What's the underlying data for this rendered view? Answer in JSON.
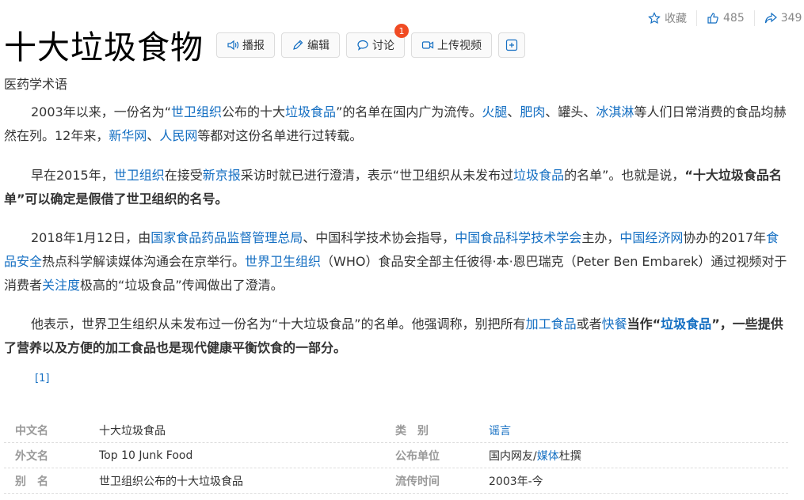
{
  "topbar": {
    "collect_label": "收藏",
    "like_count": "485",
    "share_count": "349"
  },
  "title": "十大垃圾食物",
  "actions": {
    "play": "播报",
    "edit": "编辑",
    "discuss": "讨论",
    "discuss_badge": "1",
    "upload": "上传视频"
  },
  "subtitle": "医药学术语",
  "p1": {
    "t1": "2003年以来，一份名为“",
    "l1": "世卫组织",
    "t2": "公布的十大",
    "l2": "垃圾食品",
    "t3": "”的名单在国内广为流传。",
    "l3": "火腿",
    "t4": "、",
    "l4": "肥肉",
    "t5": "、罐头、",
    "l5": "冰淇淋",
    "t6": "等人们日常消费的食品均赫然在列。12年来，",
    "l6": "新华网",
    "t7": "、",
    "l7": "人民网",
    "t8": "等都对这份名单进行过转载。"
  },
  "p2": {
    "t1": "早在2015年，",
    "l1": "世卫组织",
    "t2": "在接受",
    "l2": "新京报",
    "t3": "采访时就已进行澄清，表示“世卫组织从未发布过",
    "l3": "垃圾食品",
    "t4": "的名单”。也就是说，",
    "b1": "“十大垃圾食品名单”可以确定是假借了世卫组织的名号。"
  },
  "p3": {
    "t1": "2018年1月12日，由",
    "l1": "国家食品药品监督管理总局",
    "t2": "、中国科学技术协会指导，",
    "l2": "中国食品科学技术学会",
    "t3": "主办，",
    "l3": "中国经济网",
    "t4": "协办的2017年",
    "l4": "食品安全",
    "t5": "热点科学解读媒体沟通会在京举行。",
    "l5": "世界卫生组织",
    "t6": "（WHO）食品安全部主任彼得·本·恩巴瑞克（Peter Ben Embarek）通过视频对于消费者",
    "l6": "关注度",
    "t7": "极高的“垃圾食品”传闻做出了澄清。"
  },
  "p4": {
    "t1": "他表示，世界卫生组织从未发布过一份名为“十大垃圾食品”的名单。他强调称，别把所有",
    "l1": "加工食品",
    "t2": "或者",
    "l2": "快餐",
    "b1": "当作“",
    "l3": "垃圾食品",
    "b2": "”，一些提供了营养以及方便的加工食品也是现代健康平衡饮食的一部分。"
  },
  "ref": "[1]",
  "basic_info": {
    "rows": [
      {
        "name": "中文名",
        "value": "十大垃圾食品",
        "name2": "类　别",
        "value2_link": "谣言",
        "value2_pre": "",
        "value2_post": ""
      },
      {
        "name": "外文名",
        "value": "Top 10 Junk Food",
        "name2": "公布单位",
        "value2_pre": "国内网友/",
        "value2_link": "媒体",
        "value2_post": "杜撰"
      },
      {
        "name": "别　名",
        "value": "世卫组织公布的十大垃圾食品",
        "name2": "流传时间",
        "value2_pre": "2003年-今",
        "value2_link": "",
        "value2_post": ""
      }
    ]
  },
  "colors": {
    "link": "#136ec2",
    "badge": "#f04b23"
  },
  "icons": [
    "star-icon",
    "thumbs-up-icon",
    "share-icon",
    "speaker-icon",
    "pencil-icon",
    "chat-bubble-icon",
    "video-camera-icon",
    "plus-icon"
  ]
}
